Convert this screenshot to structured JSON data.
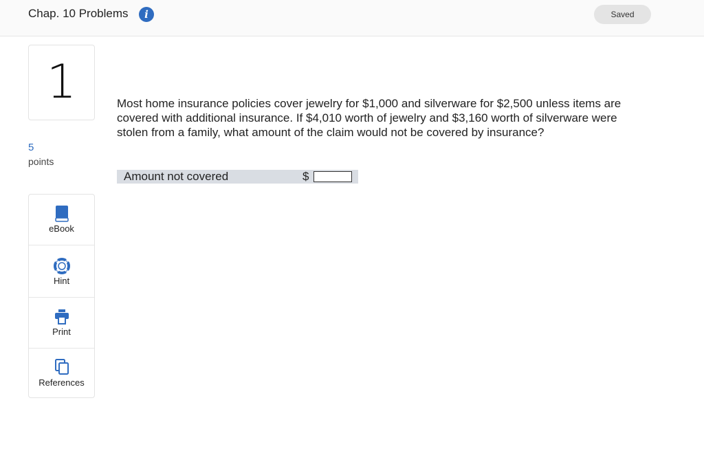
{
  "header": {
    "title": "Chap. 10 Problems",
    "info_icon": "info-icon",
    "saved_label": "Saved"
  },
  "question": {
    "number": "1",
    "points_value": "5",
    "points_label": "points",
    "text": "Most home insurance policies cover jewelry for $1,000 and silverware for $2,500 unless items are covered with additional insurance. If $4,010 worth of jewelry and $3,160 worth of silverware were stolen from a family, what amount of the claim would not be covered by insurance?",
    "answer_label": "Amount not covered",
    "currency_symbol": "$",
    "answer_value": ""
  },
  "sidebar": {
    "items": [
      {
        "label": "eBook",
        "icon": "book-icon"
      },
      {
        "label": "Hint",
        "icon": "lifebuoy-icon"
      },
      {
        "label": "Print",
        "icon": "printer-icon"
      },
      {
        "label": "References",
        "icon": "copy-icon"
      }
    ]
  },
  "colors": {
    "accent": "#2f6cc0",
    "answer_row_bg": "#d9dde3",
    "saved_pill_bg": "#e4e4e4"
  }
}
